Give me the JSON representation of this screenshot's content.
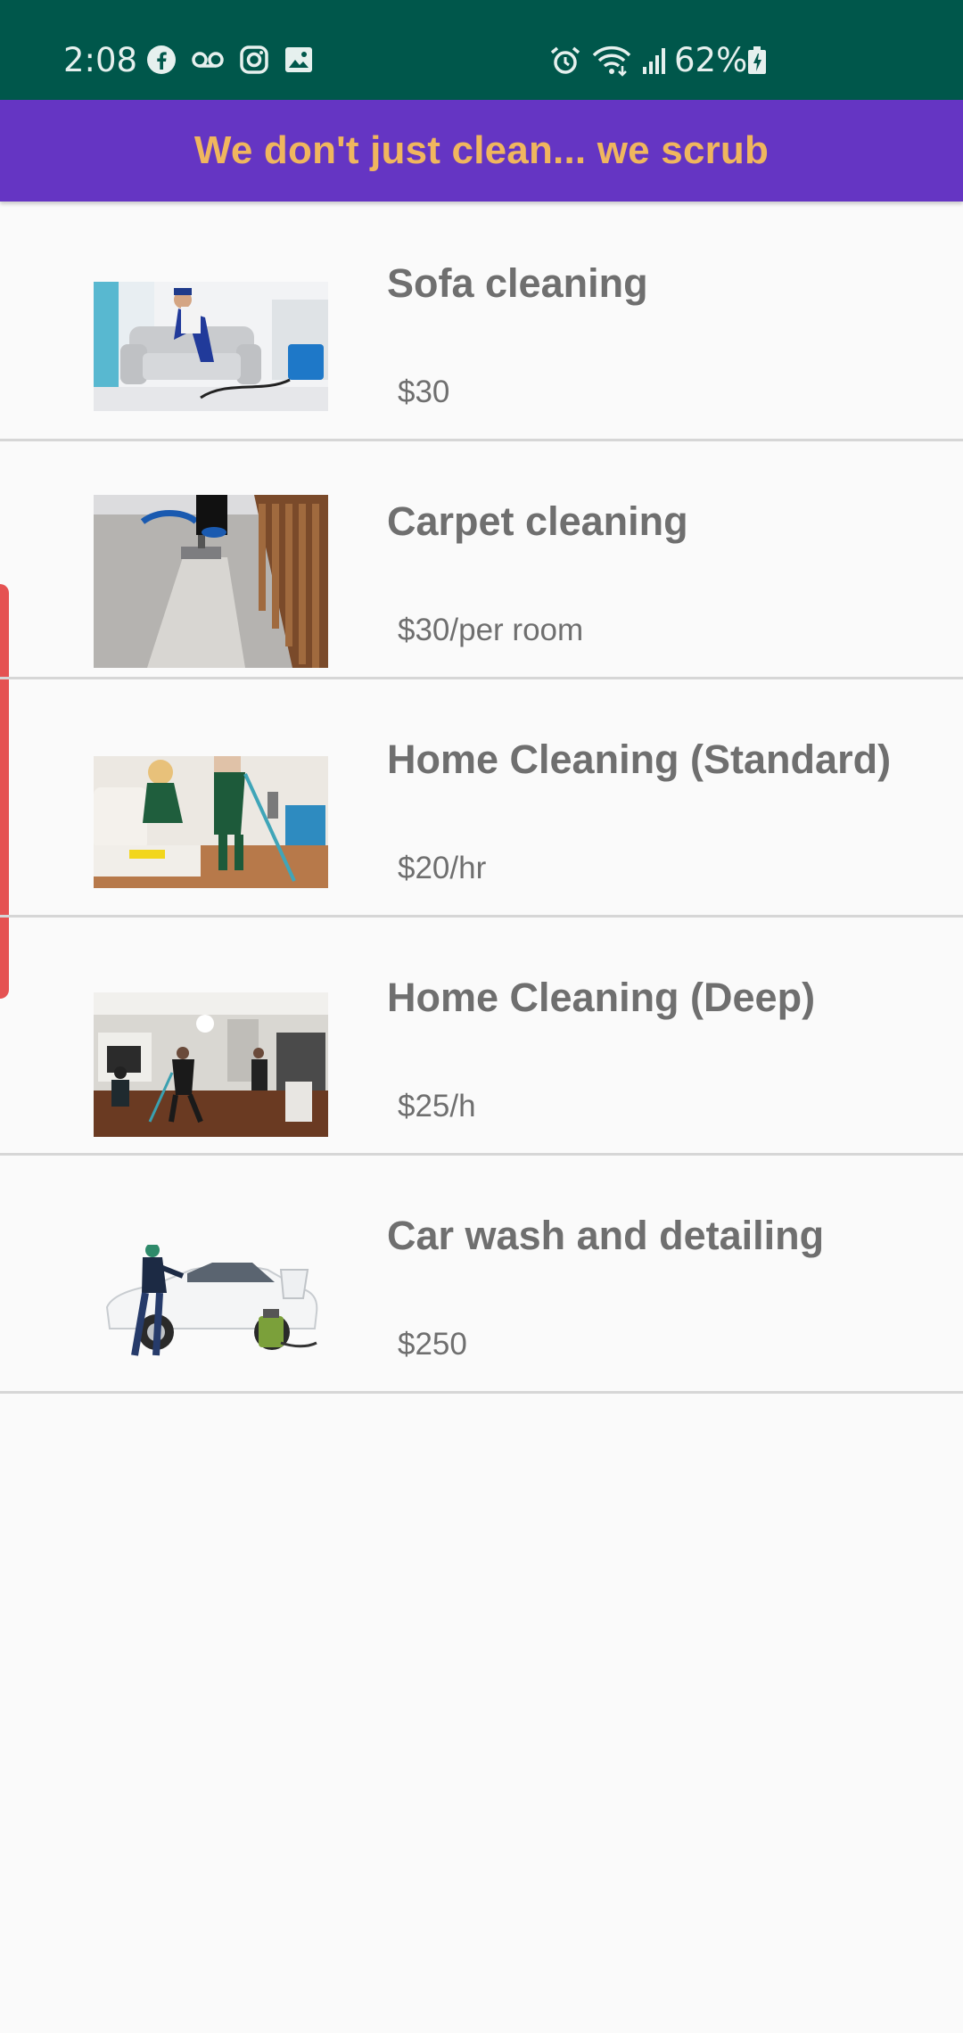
{
  "status_bar": {
    "time": "2:08",
    "battery_percent": "62%",
    "left_icons": [
      "facebook-icon",
      "voicemail-icon",
      "instagram-icon",
      "gallery-icon"
    ],
    "right_icons": [
      "alarm-icon",
      "wifi-icon",
      "signal-icon",
      "battery-icon"
    ],
    "background": "#00574b"
  },
  "app_bar": {
    "title": "We don't just clean... we scrub",
    "background": "#6535c3",
    "title_color": "#f0b65e"
  },
  "services": [
    {
      "title": "Sofa cleaning",
      "price": "$30",
      "image": "sofa-cleaning-image"
    },
    {
      "title": "Carpet cleaning",
      "price": "$30/per room",
      "image": "carpet-cleaning-image"
    },
    {
      "title": "Home Cleaning (Standard)",
      "price": "$20/hr",
      "image": "home-standard-image"
    },
    {
      "title": "Home Cleaning (Deep)",
      "price": "$25/h",
      "image": "home-deep-image"
    },
    {
      "title": "Car wash and detailing",
      "price": "$250",
      "image": "car-wash-image"
    }
  ]
}
